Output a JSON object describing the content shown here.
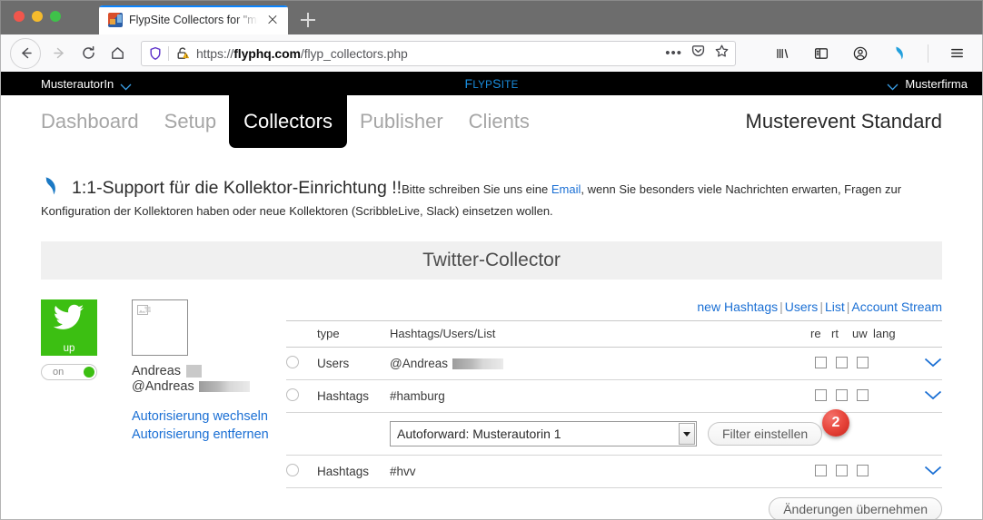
{
  "browser": {
    "tab": {
      "title": "FlypSite Collectors for \"musterf",
      "close_label": "×"
    },
    "newtab_label": "+",
    "url": {
      "scheme": "https://",
      "host": "flyphq.com",
      "path": "/flyp_collectors.php"
    },
    "icons": {
      "back": "back-arrow-icon",
      "forward": "forward-arrow-icon",
      "reload": "reload-icon",
      "home": "home-icon",
      "shield": "shield-icon",
      "lock_warning": "lock-warning-icon",
      "page_actions": "ellipsis-icon",
      "pocket": "pocket-icon",
      "bookmark": "star-icon",
      "library": "library-icon",
      "sidebar": "sidebar-icon",
      "account": "account-icon",
      "extension": "dolphin-extension-icon",
      "menu": "hamburger-menu-icon"
    }
  },
  "topbar": {
    "user": "MusterautorIn",
    "brand_first": "F",
    "brand_rest1": "LYP",
    "brand_second": "S",
    "brand_rest2": "ITE",
    "company": "Musterfirma"
  },
  "nav": {
    "items": [
      {
        "label": "Dashboard",
        "active": false
      },
      {
        "label": "Setup",
        "active": false
      },
      {
        "label": "Collectors",
        "active": true
      },
      {
        "label": "Publisher",
        "active": false
      },
      {
        "label": "Clients",
        "active": false
      }
    ],
    "event_title": "Musterevent Standard"
  },
  "support": {
    "heading": "1:1-Support für die Kollektor-Einrichtung !!",
    "body_before": "Bitte schreiben Sie uns eine ",
    "link": "Email",
    "body_after": ", wenn Sie besonders viele Nachrichten erwarten, Fragen zur Konfiguration der Kollektoren haben oder neue Kollektoren (ScribbleLive, Slack) einsetzen wollen."
  },
  "section": {
    "title": "Twitter-Collector"
  },
  "account": {
    "status_label": "up",
    "toggle_label": "on",
    "toggle_state": "on",
    "name": "Andreas",
    "handle": "@Andreas",
    "links": [
      "Autorisierung wechseln",
      "Autorisierung entfernen"
    ]
  },
  "table": {
    "header_links": [
      {
        "label": "new Hashtags"
      },
      {
        "label": "Users"
      },
      {
        "label": "List"
      },
      {
        "label": "Account Stream"
      }
    ],
    "link_separator": "|",
    "columns": {
      "type": "type",
      "main": "Hashtags/Users/List",
      "re": "re",
      "rt": "rt",
      "uw": "uw",
      "lang": "lang"
    },
    "rows": [
      {
        "type": "Users",
        "value": "@Andreas",
        "redacted": true,
        "re": false,
        "rt": false,
        "uw": false
      },
      {
        "type": "Hashtags",
        "value": "#hamburg",
        "redacted": false,
        "re": false,
        "rt": false,
        "uw": false
      },
      {
        "type": "Hashtags",
        "value": "#hvv",
        "redacted": false,
        "re": false,
        "rt": false,
        "uw": false
      }
    ],
    "filter": {
      "selected": "Autoforward: Musterautorin 1",
      "options": [
        "Autoforward: Musterautorin 1"
      ],
      "button_label": "Filter einstellen",
      "badge": "2"
    },
    "apply_label": "Änderungen übernehmen"
  },
  "colors": {
    "brand_blue": "#1a8fe0",
    "link_blue": "#1a6fd4",
    "twitter_green": "#3cbf12",
    "badge_red": "#e8463c",
    "nav_active_bg": "#000000"
  }
}
